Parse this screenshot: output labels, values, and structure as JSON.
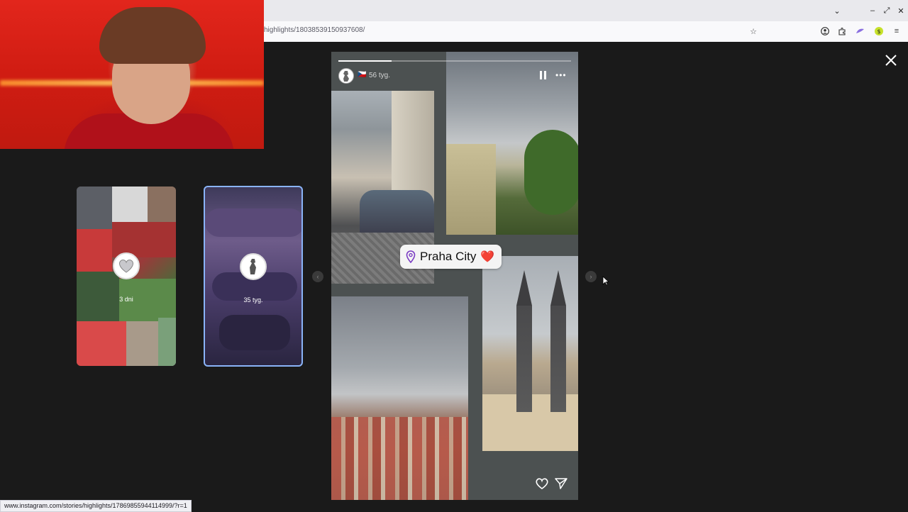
{
  "browser": {
    "url": "highlights/18038539150937608/",
    "status_url": "www.instagram.com/stories/highlights/17869855944114999/?r=1",
    "icons": [
      "bookmark-star-icon",
      "account-icon",
      "extensions-icon",
      "addon-icon",
      "addon-green-icon",
      "menu-icon"
    ],
    "window_controls": [
      "chevron-down-icon",
      "minimize-icon",
      "maximize-icon",
      "close-icon"
    ]
  },
  "highlights": [
    {
      "label": "3 dni",
      "avatar_icon": "silver-heart-icon",
      "selected": false
    },
    {
      "label": "35 tyg.",
      "avatar_icon": "statue-icon",
      "selected": true
    }
  ],
  "story": {
    "time": "56 tyg.",
    "flag": "🇨🇿",
    "progress": 0.23,
    "location_label": "Praha City",
    "location_emoji": "❤️"
  },
  "colors": {
    "background": "#1a1a1a",
    "selected_border": "#8ab4f8",
    "sticker_bg": "#f4f4f4",
    "pin_purple": "#7a3cc4"
  }
}
